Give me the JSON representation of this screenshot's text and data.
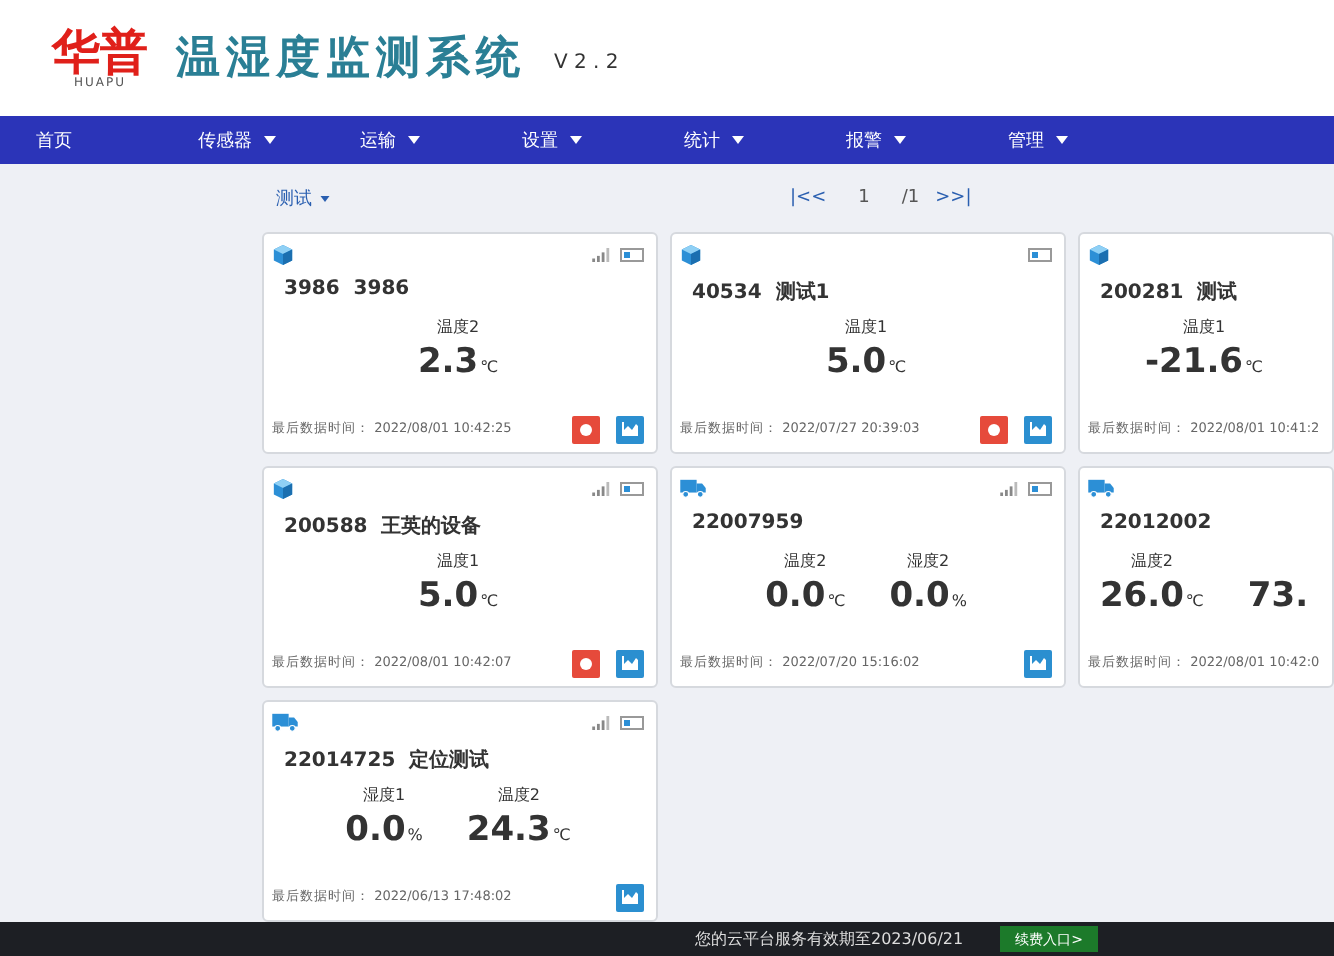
{
  "header": {
    "logo_text": "华普",
    "logo_subtext": "HUAPU",
    "title": "温湿度监测系统",
    "version": "V 2 . 2"
  },
  "nav": [
    {
      "label": "首页",
      "dropdown": false
    },
    {
      "label": "传感器",
      "dropdown": true
    },
    {
      "label": "运输",
      "dropdown": true
    },
    {
      "label": "设置",
      "dropdown": true
    },
    {
      "label": "统计",
      "dropdown": true
    },
    {
      "label": "报警",
      "dropdown": true
    },
    {
      "label": "管理",
      "dropdown": true
    }
  ],
  "group_selector": {
    "label": "测试"
  },
  "pager": {
    "first": "|<<",
    "page": "1",
    "total": "/1",
    "last": ">>|"
  },
  "cards": [
    {
      "kind": "cube",
      "title": "3986  3986",
      "signal": true,
      "battery": true,
      "readings": [
        {
          "label": "温度2",
          "value": "2.3",
          "unit": "℃"
        }
      ],
      "time_label": "最后数据时间：",
      "time": "2022/08/01 10:42:25",
      "alarm_button": true,
      "chart_button": true
    },
    {
      "kind": "cube",
      "title": "40534  测试1",
      "signal": false,
      "battery": true,
      "readings": [
        {
          "label": "温度1",
          "value": "5.0",
          "unit": "℃"
        }
      ],
      "time_label": "最后数据时间：",
      "time": "2022/07/27 20:39:03",
      "alarm_button": true,
      "chart_button": true
    },
    {
      "kind": "cube",
      "title": "200281  测试",
      "signal": false,
      "battery": false,
      "readings": [
        {
          "label": "温度1",
          "value": "-21.6",
          "unit": "℃"
        }
      ],
      "time_label": "最后数据时间：",
      "time": "2022/08/01 10:41:2",
      "alarm_button": false,
      "chart_button": false
    },
    {
      "kind": "cube",
      "title": "200588  王英的设备",
      "signal": true,
      "battery": true,
      "readings": [
        {
          "label": "温度1",
          "value": "5.0",
          "unit": "℃"
        }
      ],
      "time_label": "最后数据时间：",
      "time": "2022/08/01 10:42:07",
      "alarm_button": true,
      "chart_button": true
    },
    {
      "kind": "truck",
      "title": "22007959",
      "signal": true,
      "battery": true,
      "readings": [
        {
          "label": "温度2",
          "value": "0.0",
          "unit": "℃"
        },
        {
          "label": "湿度2",
          "value": "0.0",
          "unit": "%"
        }
      ],
      "time_label": "最后数据时间：",
      "time": "2022/07/20 15:16:02",
      "alarm_button": false,
      "chart_button": true
    },
    {
      "kind": "truck",
      "title": "22012002",
      "signal": false,
      "battery": false,
      "readings": [
        {
          "label": "温度2",
          "value": "26.0",
          "unit": "℃"
        },
        {
          "value": "73."
        }
      ],
      "time_label": "最后数据时间：",
      "time": "2022/08/01 10:42:0",
      "alarm_button": false,
      "chart_button": false
    },
    {
      "kind": "truck",
      "title": "22014725  定位测试",
      "signal": true,
      "battery": true,
      "readings": [
        {
          "label": "湿度1",
          "value": "0.0",
          "unit": "%"
        },
        {
          "label": "温度2",
          "value": "24.3",
          "unit": "℃"
        }
      ],
      "time_label": "最后数据时间：",
      "time": "2022/06/13 17:48:02",
      "alarm_button": false,
      "chart_button": true
    }
  ],
  "footer": {
    "notice": "您的云平台服务有效期至2023/06/21",
    "renew_button": "续费入口>"
  }
}
